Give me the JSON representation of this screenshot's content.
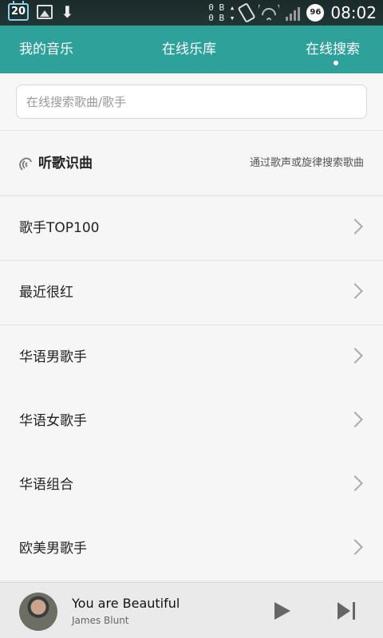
{
  "status_bar": {
    "date": "20",
    "net_up": "0 B",
    "net_down": "0 B",
    "battery": "96",
    "time": "08:02"
  },
  "tabs": [
    {
      "label": "我的音乐"
    },
    {
      "label": "在线乐库"
    },
    {
      "label": "在线搜索",
      "active": true
    }
  ],
  "search": {
    "placeholder": "在线搜索歌曲/歌手"
  },
  "listen": {
    "label": "听歌识曲",
    "hint": "通过歌声或旋律搜索歌曲"
  },
  "categories": [
    {
      "label": "歌手TOP100"
    },
    {
      "label": "最近很红"
    },
    {
      "label": "华语男歌手"
    },
    {
      "label": "华语女歌手"
    },
    {
      "label": "华语组合"
    },
    {
      "label": "欧美男歌手"
    }
  ],
  "player": {
    "song": "You are Beautiful",
    "artist": "James Blunt"
  },
  "colors": {
    "header": "#2ea19a",
    "status_bar": "#1f3030"
  },
  "icons": {
    "listen": "soundwave-icon",
    "row_arrow": "chevron-right-icon",
    "play": "play-icon",
    "next": "skip-next-icon"
  }
}
